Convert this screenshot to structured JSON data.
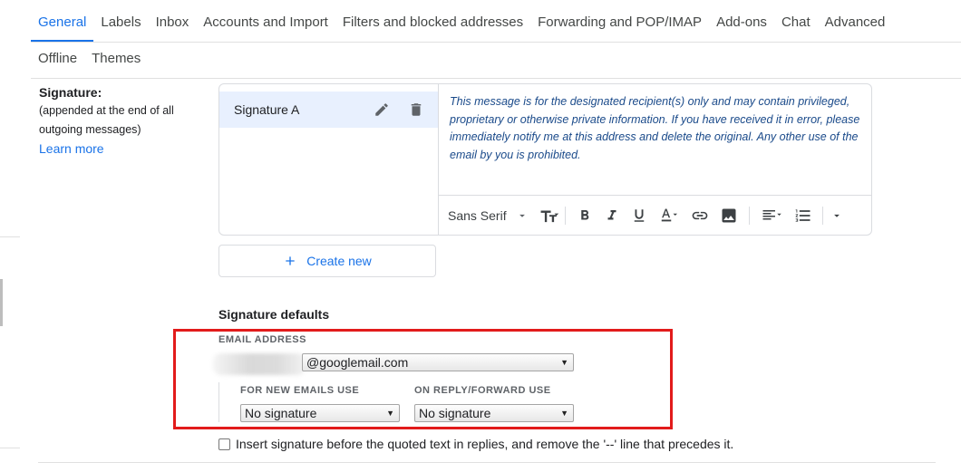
{
  "tabs_row1": [
    "General",
    "Labels",
    "Inbox",
    "Accounts and Import",
    "Filters and blocked addresses",
    "Forwarding and POP/IMAP",
    "Add-ons",
    "Chat",
    "Advanced"
  ],
  "tabs_row2": [
    "Offline",
    "Themes"
  ],
  "signature": {
    "title": "Signature:",
    "description": "(appended at the end of all outgoing messages)",
    "learn_more": "Learn more",
    "selected_name": "Signature A",
    "body": "This message is for the designated recipient(s) only and may contain privileged, proprietary or otherwise private information. If you have received it in error, please immediately notify me at this address and delete the original. Any other use of the email by you is prohibited.",
    "font": "Sans Serif",
    "create_new": "Create new"
  },
  "defaults": {
    "title": "Signature defaults",
    "email_label": "EMAIL ADDRESS",
    "email_value": "@googlemail.com",
    "new_label": "FOR NEW EMAILS USE",
    "new_value": "No signature",
    "reply_label": "ON REPLY/FORWARD USE",
    "reply_value": "No signature"
  },
  "insert_before_quote": "Insert signature before the quoted text in replies, and remove the '--' line that precedes it.",
  "colors": {
    "accent": "#1a73e8",
    "highlight_border": "#e21b1b"
  }
}
